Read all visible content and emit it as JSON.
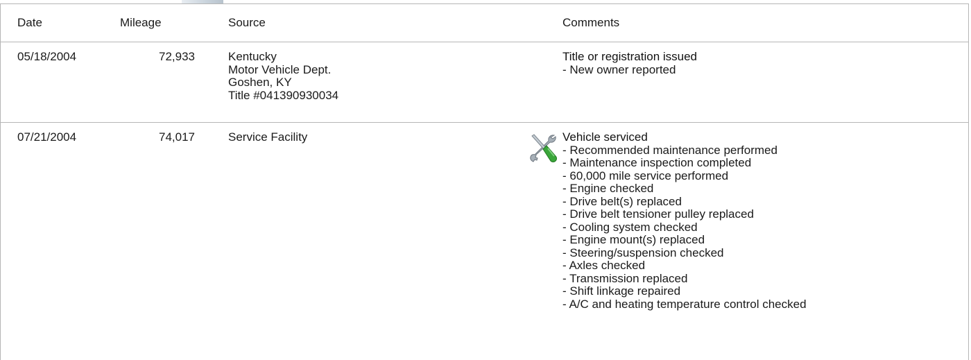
{
  "table": {
    "headers": {
      "date": "Date",
      "mileage": "Mileage",
      "source": "Source",
      "comments": "Comments"
    },
    "rows": [
      {
        "date": "05/18/2004",
        "mileage": "72,933",
        "source": [
          "Kentucky",
          "Motor Vehicle Dept.",
          "Goshen, KY",
          "Title #041390930034"
        ],
        "comment_title": "Title or registration issued",
        "comment_items": [
          "- New owner reported"
        ],
        "icon": ""
      },
      {
        "date": "07/21/2004",
        "mileage": "74,017",
        "source": [
          "Service Facility"
        ],
        "comment_title": "Vehicle serviced",
        "comment_items": [
          "- Recommended maintenance performed",
          "- Maintenance inspection completed",
          "- 60,000 mile service performed",
          "- Engine checked",
          "- Drive belt(s) replaced",
          "- Drive belt tensioner pulley replaced",
          "- Cooling system checked",
          "- Engine mount(s) replaced",
          "- Steering/suspension checked",
          "- Axles checked",
          "- Transmission replaced",
          "- Shift linkage repaired",
          "- A/C and heating temperature control checked"
        ],
        "icon": "wrench-screwdriver-icon"
      }
    ]
  },
  "colors": {
    "border": "#b5b5b5",
    "text": "#1a1a1a",
    "icon_green": "#3aa63a",
    "icon_metal": "#9aa3ab"
  }
}
